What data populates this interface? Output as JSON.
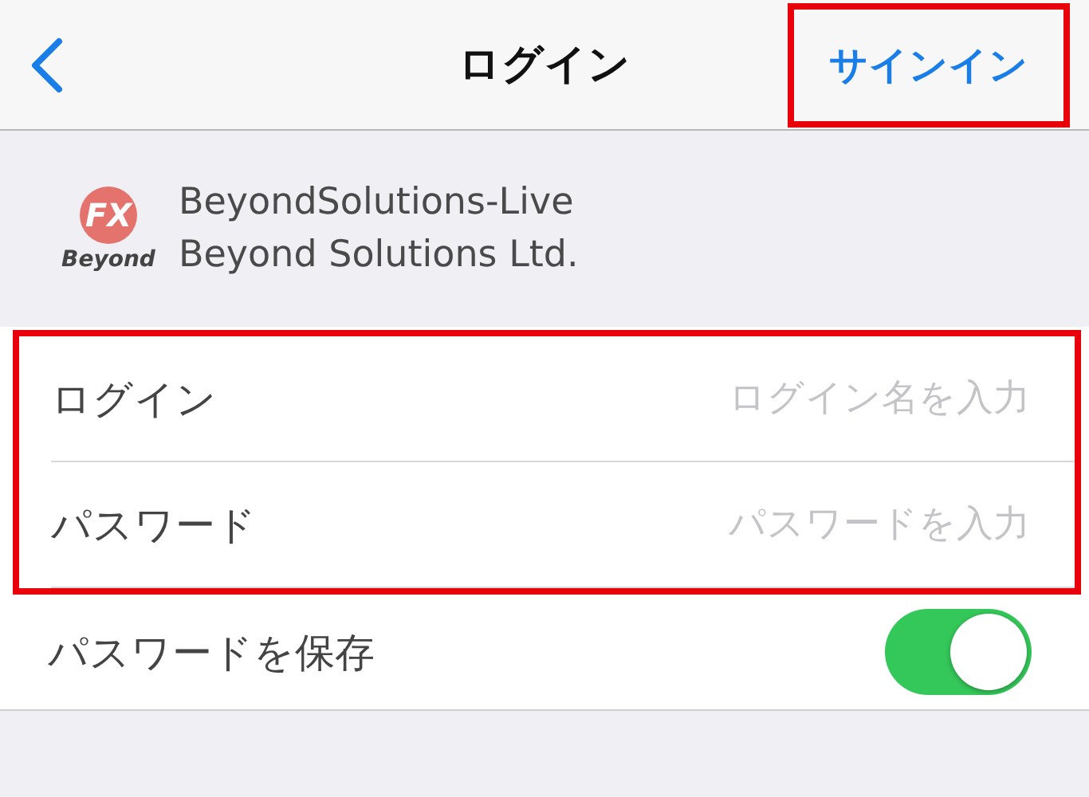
{
  "nav_bar": {
    "title": "ログイン",
    "action": {
      "label": "サインイン",
      "highlighted": true
    }
  },
  "server": {
    "logo": {
      "mark": "FX",
      "wordmark": "Beyond"
    },
    "name": "BeyondSolutions-Live",
    "company": "Beyond Solutions Ltd."
  },
  "form": {
    "highlighted": true,
    "fields": [
      {
        "label": "ログイン",
        "placeholder": "ログイン名を入力"
      },
      {
        "label": "パスワード",
        "placeholder": "パスワードを入力"
      }
    ]
  },
  "save_password": {
    "label": "パスワードを保存",
    "on": true
  }
}
